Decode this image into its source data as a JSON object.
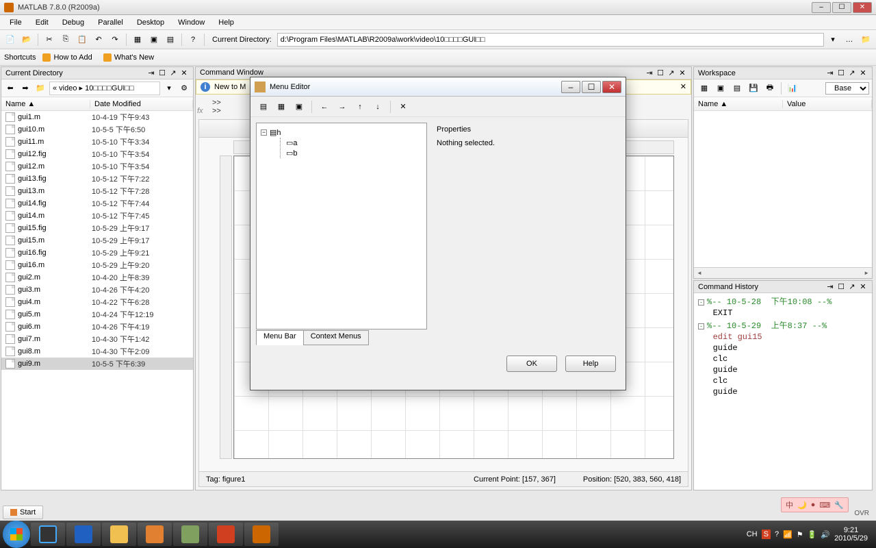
{
  "titlebar": {
    "title": "MATLAB 7.8.0 (R2009a)"
  },
  "menu": {
    "items": [
      "File",
      "Edit",
      "Debug",
      "Parallel",
      "Desktop",
      "Window",
      "Help"
    ]
  },
  "toolbar": {
    "curdir_label": "Current Directory:",
    "curdir_value": "d:\\Program Files\\MATLAB\\R2009a\\work\\video\\10□□□□GUI□□"
  },
  "shortcuts": {
    "label": "Shortcuts",
    "howto": "How to Add",
    "whats": "What's New"
  },
  "currentdir": {
    "title": "Current Directory",
    "path_parts": "« video ▸ 10□□□□GUI□□",
    "cols": {
      "name": "Name ▲",
      "date": "Date Modified"
    },
    "files": [
      {
        "n": "gui1.m",
        "d": "10-4-19 下午9:43"
      },
      {
        "n": "gui10.m",
        "d": "10-5-5 下午6:50"
      },
      {
        "n": "gui11.m",
        "d": "10-5-10 下午3:34"
      },
      {
        "n": "gui12.fig",
        "d": "10-5-10 下午3:54"
      },
      {
        "n": "gui12.m",
        "d": "10-5-10 下午3:54"
      },
      {
        "n": "gui13.fig",
        "d": "10-5-12 下午7:22"
      },
      {
        "n": "gui13.m",
        "d": "10-5-12 下午7:28"
      },
      {
        "n": "gui14.fig",
        "d": "10-5-12 下午7:44"
      },
      {
        "n": "gui14.m",
        "d": "10-5-12 下午7:45"
      },
      {
        "n": "gui15.fig",
        "d": "10-5-29 上午9:17"
      },
      {
        "n": "gui15.m",
        "d": "10-5-29 上午9:17"
      },
      {
        "n": "gui16.fig",
        "d": "10-5-29 上午9:21"
      },
      {
        "n": "gui16.m",
        "d": "10-5-29 上午9:20"
      },
      {
        "n": "gui2.m",
        "d": "10-4-20 上午8:39"
      },
      {
        "n": "gui3.m",
        "d": "10-4-26 下午4:20"
      },
      {
        "n": "gui4.m",
        "d": "10-4-22 下午6:28"
      },
      {
        "n": "gui5.m",
        "d": "10-4-24 下午12:19"
      },
      {
        "n": "gui6.m",
        "d": "10-4-26 下午4:19"
      },
      {
        "n": "gui7.m",
        "d": "10-4-30 下午1:42"
      },
      {
        "n": "gui8.m",
        "d": "10-4-30 下午2:09"
      },
      {
        "n": "gui9.m",
        "d": "10-5-5 下午6:39"
      }
    ],
    "selected": "gui9.m"
  },
  "cmdwin": {
    "title": "Command Window",
    "newto": "New to M",
    "prompt1": ">>",
    "prompt2": ">>"
  },
  "workspace": {
    "title": "Workspace",
    "base": "Base",
    "cols": {
      "name": "Name ▲",
      "value": "Value"
    }
  },
  "history": {
    "title": "Command History",
    "lines": [
      {
        "t": "%-- 10-5-28  下午10:08 --%",
        "c": "g",
        "toggle": "-"
      },
      {
        "t": "EXIT",
        "c": "b",
        "indent": 1
      },
      {
        "t": "%-- 10-5-29  上午8:37 --%",
        "c": "g",
        "toggle": "-"
      },
      {
        "t": "edit gui15",
        "c": "r",
        "indent": 1
      },
      {
        "t": "guide",
        "c": "b",
        "indent": 1
      },
      {
        "t": "clc",
        "c": "b",
        "indent": 1
      },
      {
        "t": "guide",
        "c": "b",
        "indent": 1
      },
      {
        "t": "clc",
        "c": "b",
        "indent": 1
      },
      {
        "t": "guide",
        "c": "b",
        "indent": 1
      }
    ]
  },
  "guide": {
    "tag": "Tag: figure1",
    "point": "Current Point:   [157, 367]",
    "position": "Position:  [520, 383, 560, 418]"
  },
  "menueditor": {
    "title": "Menu Editor",
    "tree_root": "h",
    "tree_children": [
      "a",
      "b"
    ],
    "tabs": {
      "bar": "Menu Bar",
      "ctx": "Context Menus"
    },
    "props_title": "Properties",
    "nothing": "Nothing selected.",
    "ok": "OK",
    "help": "Help"
  },
  "start": {
    "label": "Start"
  },
  "ovr": "OVR",
  "tray": {
    "ch": "CH",
    "time": "9:21",
    "date": "2010/5/29"
  },
  "lang": {
    "zhong": "中"
  }
}
